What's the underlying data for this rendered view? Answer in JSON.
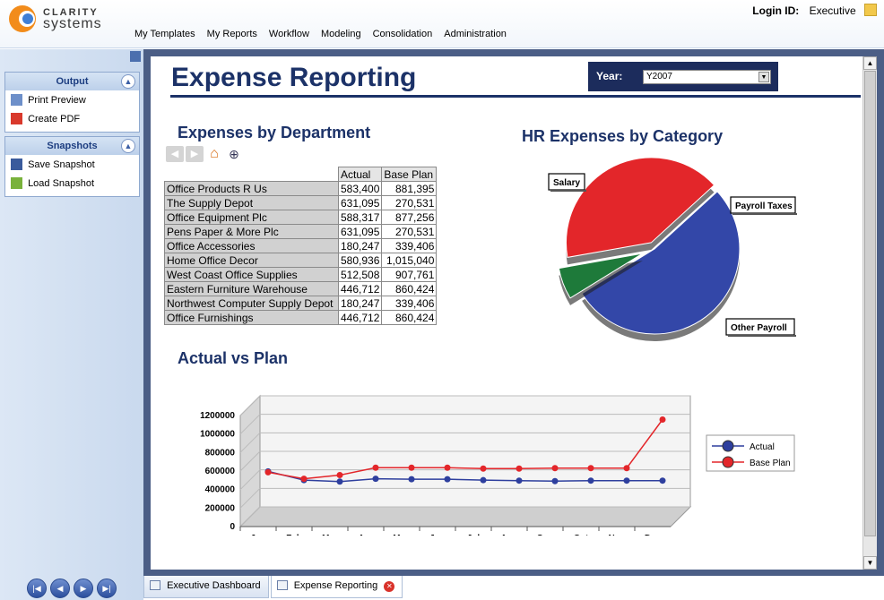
{
  "app": {
    "logo_line1": "CLARITY",
    "logo_line2": "systems",
    "login_label": "Login ID:",
    "login_value": "Executive"
  },
  "menu": [
    "My Templates",
    "My Reports",
    "Workflow",
    "Modeling",
    "Consolidation",
    "Administration"
  ],
  "sidebar": {
    "output_title": "Output",
    "output_items": [
      "Print Preview",
      "Create PDF"
    ],
    "snapshots_title": "Snapshots",
    "snapshot_items": [
      "Save Snapshot",
      "Load Snapshot"
    ]
  },
  "tabs": [
    "Executive Dashboard",
    "Expense Reporting"
  ],
  "report": {
    "title": "Expense Reporting",
    "year_label": "Year:",
    "year_value": "Y2007",
    "dept_title": "Expenses by Department",
    "hr_title": "HR Expenses by Category",
    "avp_title": "Actual vs Plan"
  },
  "table": {
    "headers": [
      "Actual",
      "Base Plan"
    ],
    "rows": [
      [
        "Office Products R Us",
        "583,400",
        "881,395"
      ],
      [
        "The Supply Depot",
        "631,095",
        "270,531"
      ],
      [
        "Office Equipment Plc",
        "588,317",
        "877,256"
      ],
      [
        "Pens Paper & More Plc",
        "631,095",
        "270,531"
      ],
      [
        "Office Accessories",
        "180,247",
        "339,406"
      ],
      [
        "Home Office Decor",
        "580,936",
        "1,015,040"
      ],
      [
        "West Coast Office Supplies",
        "512,508",
        "907,761"
      ],
      [
        "Eastern Furniture Warehouse",
        "446,712",
        "860,424"
      ],
      [
        "Northwest Computer Supply Depot",
        "180,247",
        "339,406"
      ],
      [
        "Office Furnishings",
        "446,712",
        "860,424"
      ]
    ]
  },
  "chart_data": [
    {
      "type": "pie",
      "title": "HR Expenses by Category",
      "categories": [
        "Salary",
        "Payroll Taxes",
        "Other Payroll"
      ],
      "values": [
        53,
        6,
        41
      ],
      "colors": [
        "#3347a8",
        "#1e7a3a",
        "#e3262a"
      ]
    },
    {
      "type": "line",
      "title": "Actual vs Plan",
      "categories": [
        "Jan",
        "Feb",
        "Mar",
        "Apr",
        "May",
        "Jun",
        "Jul",
        "Aug",
        "Sep",
        "Oct",
        "Nov",
        "Dec"
      ],
      "ylim": [
        0,
        1200000
      ],
      "yticks": [
        "0",
        "200000",
        "400000",
        "600000",
        "800000",
        "1000000",
        "1200000"
      ],
      "legend_position": "right",
      "series": [
        {
          "name": "Actual",
          "color": "#2e3f9e",
          "values": [
            490000,
            395000,
            380000,
            410000,
            405000,
            405000,
            395000,
            390000,
            385000,
            390000,
            390000,
            390000
          ]
        },
        {
          "name": "Base Plan",
          "color": "#e3262a",
          "values": [
            480000,
            410000,
            450000,
            530000,
            530000,
            530000,
            520000,
            520000,
            525000,
            525000,
            525000,
            1050000
          ]
        }
      ]
    }
  ]
}
